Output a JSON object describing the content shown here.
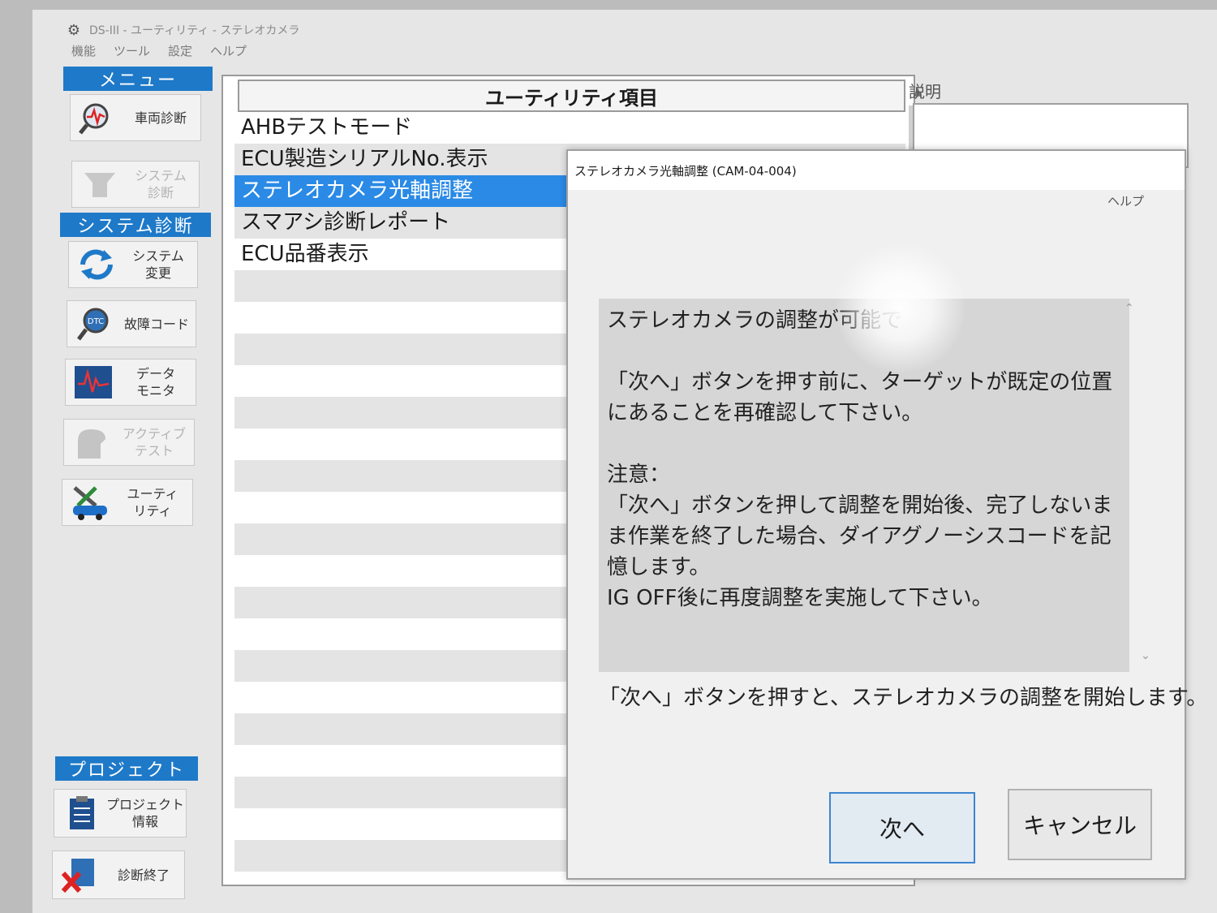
{
  "window": {
    "title": "DS-III - ユーティリティ - ステレオカメラ",
    "icon": "tool-icon"
  },
  "menubar": [
    "機能",
    "ツール",
    "設定",
    "ヘルプ"
  ],
  "sidebar": {
    "sections": [
      "メニュー",
      "システム診断",
      "プロジェクト"
    ],
    "buttons": [
      {
        "label": "車両診断",
        "icon": "vehicle-diagnosis-icon",
        "enabled": true
      },
      {
        "label": "システム\n診断",
        "icon": "system-diagnosis-icon",
        "enabled": false
      },
      {
        "label": "システム\n変更",
        "icon": "system-change-icon",
        "enabled": true
      },
      {
        "label": "故障コード",
        "icon": "dtc-icon",
        "enabled": true
      },
      {
        "label": "データ\nモニタ",
        "icon": "data-monitor-icon",
        "enabled": true
      },
      {
        "label": "アクティブ\nテスト",
        "icon": "active-test-icon",
        "enabled": false
      },
      {
        "label": "ユーティ\nリティ",
        "icon": "utility-icon",
        "enabled": true
      },
      {
        "label": "プロジェクト\n情報",
        "icon": "project-info-icon",
        "enabled": true
      },
      {
        "label": "診断終了",
        "icon": "end-diagnosis-icon",
        "enabled": true
      }
    ]
  },
  "list": {
    "header": "ユーティリティ項目",
    "items": [
      "AHBテストモード",
      "ECU製造シリアルNo.表示",
      "ステレオカメラ光軸調整",
      "スマアシ診断レポート",
      "ECU品番表示"
    ],
    "selected_index": 2
  },
  "description": {
    "label": "説明"
  },
  "dialog": {
    "title": "ステレオカメラ光軸調整 (CAM-04-004)",
    "menu": "ヘルプ",
    "body": "ステレオカメラの調整が可能で\n\n「次へ」ボタンを押す前に、ターゲットが既定の位置にあることを再確認して下さい。\n\n注意：\n「次へ」ボタンを押して調整を開始後、完了しないまま作業を終了した場合、ダイアグノーシスコードを記憶します。\nIG OFF後に再度調整を実施して下さい。",
    "footer": "「次へ」ボタンを押すと、ステレオカメラの調整を開始します。",
    "next_label": "次へ",
    "cancel_label": "キャンセル"
  },
  "colors": {
    "accent": "#1e79c8",
    "selection": "#2a8ae6",
    "dialog_body_bg": "#d6d6d6"
  }
}
